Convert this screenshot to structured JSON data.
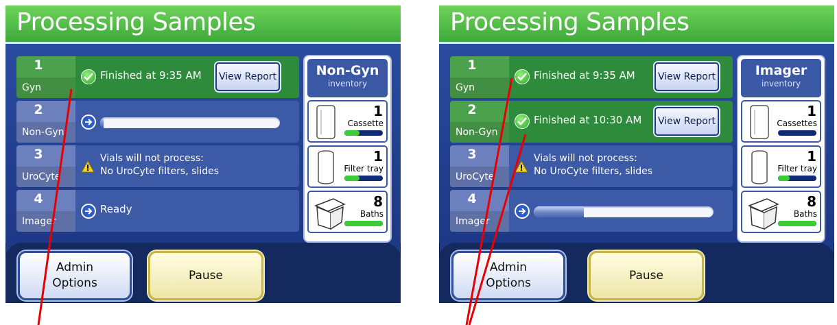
{
  "screens": [
    {
      "title": "Processing Samples",
      "rows": [
        {
          "number": "1",
          "name": "Gyn",
          "message": "Finished at  9:35 AM",
          "action": "View Report"
        },
        {
          "number": "2",
          "name": "Non-Gyn",
          "progress": 0.0
        },
        {
          "number": "3",
          "name": "UroCyte",
          "message_line1": "Vials will not process:",
          "message_line2": "No UroCyte filters, slides"
        },
        {
          "number": "4",
          "name": "Imager",
          "message": "Ready"
        }
      ],
      "inventory": {
        "title": "Non-Gyn",
        "subtitle": "inventory",
        "items": [
          {
            "count": "1",
            "label": "Cassette",
            "level": 0.4
          },
          {
            "count": "1",
            "label": "Filter tray",
            "level": 0.4
          },
          {
            "count": "8",
            "label": "Baths",
            "level": 1.0
          }
        ]
      },
      "buttons": {
        "admin_line1": "Admin",
        "admin_line2": "Options",
        "pause": "Pause"
      }
    },
    {
      "title": "Processing Samples",
      "rows": [
        {
          "number": "1",
          "name": "Gyn",
          "message": "Finished at  9:35 AM",
          "action": "View Report"
        },
        {
          "number": "2",
          "name": "Non-Gyn",
          "message": "Finished at  10:30 AM",
          "action": "View Report"
        },
        {
          "number": "3",
          "name": "UroCyte",
          "message_line1": "Vials will not process:",
          "message_line2": "No UroCyte filters, slides"
        },
        {
          "number": "4",
          "name": "Imager",
          "progress": 0.28
        }
      ],
      "inventory": {
        "title": "Imager",
        "subtitle": "inventory",
        "items": [
          {
            "count": "1",
            "label": "Cassettes",
            "level": 0.0
          },
          {
            "count": "1",
            "label": "Filter tray",
            "level": 0.3
          },
          {
            "count": "8",
            "label": "Baths",
            "level": 1.0
          }
        ]
      },
      "buttons": {
        "admin_line1": "Admin",
        "admin_line2": "Options",
        "pause": "Pause"
      }
    }
  ],
  "colors": {
    "header": "#3ea83a",
    "panel": "#1e3a86",
    "annotation_line": "#e00000"
  }
}
